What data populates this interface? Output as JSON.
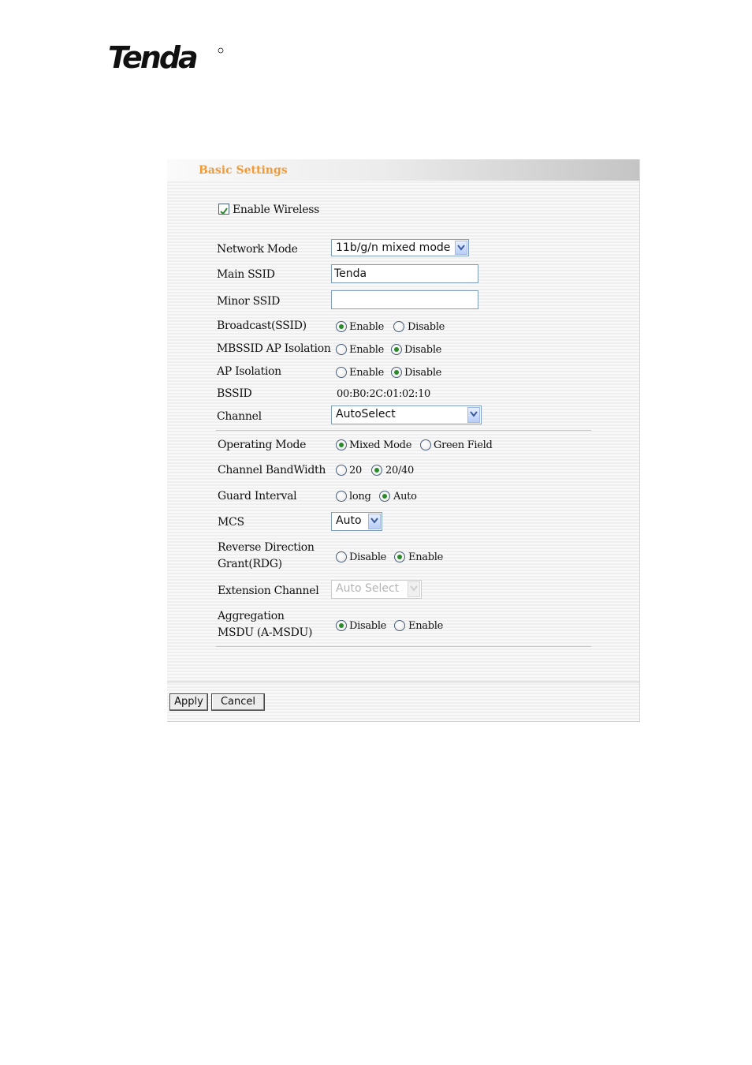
{
  "brand": {
    "logo_text": "Tenda"
  },
  "panel": {
    "title": "Basic Settings"
  },
  "enable_wireless": {
    "label": "Enable Wireless",
    "checked": true
  },
  "fields": {
    "network_mode": {
      "label": "Network Mode",
      "value": "11b/g/n mixed mode"
    },
    "main_ssid": {
      "label": "Main SSID",
      "value": "Tenda"
    },
    "minor_ssid": {
      "label": "Minor SSID",
      "value": ""
    },
    "broadcast_ssid": {
      "label": "Broadcast(SSID)",
      "option1": "Enable",
      "option2": "Disable",
      "selected": "Enable"
    },
    "mbssid_ap_isolation": {
      "label": "MBSSID AP Isolation",
      "option1": "Enable",
      "option2": "Disable",
      "selected": "Disable"
    },
    "ap_isolation": {
      "label": "AP Isolation",
      "option1": "Enable",
      "option2": "Disable",
      "selected": "Disable"
    },
    "bssid": {
      "label": "BSSID",
      "value": "00:B0:2C:01:02:10"
    },
    "channel": {
      "label": "Channel",
      "value": "AutoSelect"
    },
    "operating_mode": {
      "label": "Operating Mode",
      "option1": "Mixed Mode",
      "option2": "Green Field",
      "selected": "Mixed Mode"
    },
    "channel_bandwidth": {
      "label": "Channel BandWidth",
      "option1": "20",
      "option2": "20/40",
      "selected": "20/40"
    },
    "guard_interval": {
      "label": "Guard Interval",
      "option1": "long",
      "option2": "Auto",
      "selected": "Auto"
    },
    "mcs": {
      "label": "MCS",
      "value": "Auto"
    },
    "rdg": {
      "label": "Reverse Direction Grant(RDG)",
      "option1": "Disable",
      "option2": "Enable",
      "selected": "Enable"
    },
    "extension_channel": {
      "label": "Extension Channel",
      "value": "Auto Select",
      "disabled": true
    },
    "amsdu": {
      "label": "Aggregation MSDU (A-MSDU)",
      "option1": "Disable",
      "option2": "Enable",
      "selected": "Disable"
    }
  },
  "buttons": {
    "apply": "Apply",
    "cancel": "Cancel"
  },
  "colors": {
    "title": "#f19b38",
    "logo": "#111111",
    "radio_dot": "#2a8a2a",
    "input_border": "#7f9db9"
  }
}
